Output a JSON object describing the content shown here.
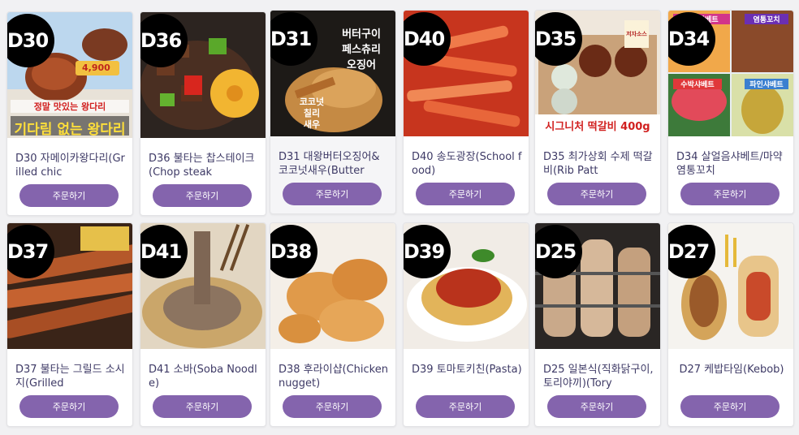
{
  "colors": {
    "accent": "#8464ad",
    "badge": "#000000",
    "name_text": "#3e3a66"
  },
  "order_label": "주문하기",
  "menu": [
    {
      "code": "D30",
      "name": "D30 자메이카왕다리(Grilled chic",
      "overlay": [
        "정말 맛있는 왕다리",
        "기다림 없는 왕다리"
      ],
      "price": "4,900"
    },
    {
      "code": "D36",
      "name": "D36 불타는 찹스테이크(Chop steak"
    },
    {
      "code": "D31",
      "name": "D31 대왕버터오징어&코코넛새우(Butter",
      "overlay": [
        "버터구이",
        "페스츄리",
        "오징어",
        "코코넛",
        "칠리",
        "새우"
      ]
    },
    {
      "code": "D40",
      "name": "D40 송도광장(School food)"
    },
    {
      "code": "D35",
      "name": "D35 최가상회 수제 떡갈비(Rib Patt",
      "overlay": [
        "시그니처 떡갈비 400g",
        "저자소스"
      ]
    },
    {
      "code": "D34",
      "name": "D34 살얼음샤베트/마약염통꼬치",
      "overlay": [
        "망고샤베트",
        "염통꼬치",
        "수박샤베트",
        "파인샤베트"
      ]
    },
    {
      "code": "D37",
      "name": "D37 불타는 그릴드 소시지(Grilled"
    },
    {
      "code": "D41",
      "name": "D41 소바(Soba Noodle)"
    },
    {
      "code": "D38",
      "name": "D38 후라이샵(Chicken nugget)"
    },
    {
      "code": "D39",
      "name": "D39 토마토키친(Pasta)"
    },
    {
      "code": "D25",
      "name": "D25 일본식(직화닭구이,토리야끼)(Tory"
    },
    {
      "code": "D27",
      "name": "D27 케밥타임(Kebob)"
    }
  ]
}
